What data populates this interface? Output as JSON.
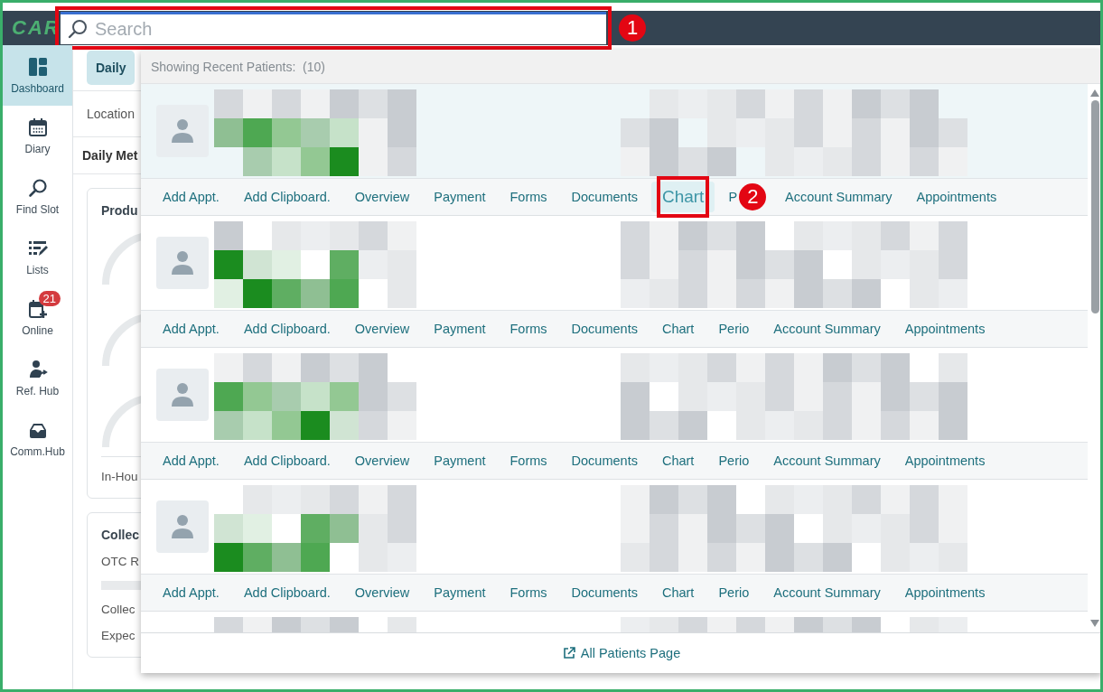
{
  "header": {
    "logo": "CAR",
    "search": {
      "placeholder": "Search",
      "callout": "1"
    }
  },
  "sidebar": {
    "items": [
      {
        "label": "Dashboard",
        "selected": true
      },
      {
        "label": "Diary",
        "selected": false
      },
      {
        "label": "Find Slot",
        "selected": false
      },
      {
        "label": "Lists",
        "selected": false
      },
      {
        "label": "Online",
        "selected": false,
        "badge": "21"
      },
      {
        "label": "Ref. Hub",
        "selected": false
      },
      {
        "label": "Comm.Hub",
        "selected": false
      }
    ]
  },
  "main": {
    "tab": "Daily",
    "location_label": "Location",
    "section_title": "Daily Met",
    "cards": [
      {
        "title": "Produ",
        "lines": [
          "In-Hou"
        ]
      },
      {
        "title": "Collec",
        "lines": [
          "OTC R",
          "Collec",
          "Expec"
        ]
      }
    ]
  },
  "dropdown": {
    "heading": "Showing Recent Patients:  (10)",
    "patients": [
      {
        "highlighted": true,
        "actions": [
          {
            "label": "Add Appt.",
            "highlighted": false
          },
          {
            "label": "Add Clipboard.",
            "highlighted": false
          },
          {
            "label": "Overview",
            "highlighted": false
          },
          {
            "label": "Payment",
            "highlighted": false
          },
          {
            "label": "Forms",
            "highlighted": false
          },
          {
            "label": "Documents",
            "highlighted": false
          },
          {
            "label": "Chart",
            "highlighted": true,
            "callout": "2"
          },
          {
            "label": "P",
            "highlighted": false
          },
          {
            "label": "Account Summary",
            "highlighted": false
          },
          {
            "label": "Appointments",
            "highlighted": false
          }
        ]
      },
      {
        "highlighted": false,
        "actions": [
          {
            "label": "Add Appt.",
            "highlighted": false
          },
          {
            "label": "Add Clipboard.",
            "highlighted": false
          },
          {
            "label": "Overview",
            "highlighted": false
          },
          {
            "label": "Payment",
            "highlighted": false
          },
          {
            "label": "Forms",
            "highlighted": false
          },
          {
            "label": "Documents",
            "highlighted": false
          },
          {
            "label": "Chart",
            "highlighted": false
          },
          {
            "label": "Perio",
            "highlighted": false
          },
          {
            "label": "Account Summary",
            "highlighted": false
          },
          {
            "label": "Appointments",
            "highlighted": false
          }
        ]
      },
      {
        "highlighted": false,
        "actions": [
          {
            "label": "Add Appt.",
            "highlighted": false
          },
          {
            "label": "Add Clipboard.",
            "highlighted": false
          },
          {
            "label": "Overview",
            "highlighted": false
          },
          {
            "label": "Payment",
            "highlighted": false
          },
          {
            "label": "Forms",
            "highlighted": false
          },
          {
            "label": "Documents",
            "highlighted": false
          },
          {
            "label": "Chart",
            "highlighted": false
          },
          {
            "label": "Perio",
            "highlighted": false
          },
          {
            "label": "Account Summary",
            "highlighted": false
          },
          {
            "label": "Appointments",
            "highlighted": false
          }
        ]
      },
      {
        "highlighted": false,
        "actions": [
          {
            "label": "Add Appt.",
            "highlighted": false
          },
          {
            "label": "Add Clipboard.",
            "highlighted": false
          },
          {
            "label": "Overview",
            "highlighted": false
          },
          {
            "label": "Payment",
            "highlighted": false
          },
          {
            "label": "Forms",
            "highlighted": false
          },
          {
            "label": "Documents",
            "highlighted": false
          },
          {
            "label": "Chart",
            "highlighted": false
          },
          {
            "label": "Perio",
            "highlighted": false
          },
          {
            "label": "Account Summary",
            "highlighted": false
          },
          {
            "label": "Appointments",
            "highlighted": false
          }
        ]
      },
      {
        "highlighted": false
      }
    ],
    "footer_link": "All Patients Page"
  }
}
